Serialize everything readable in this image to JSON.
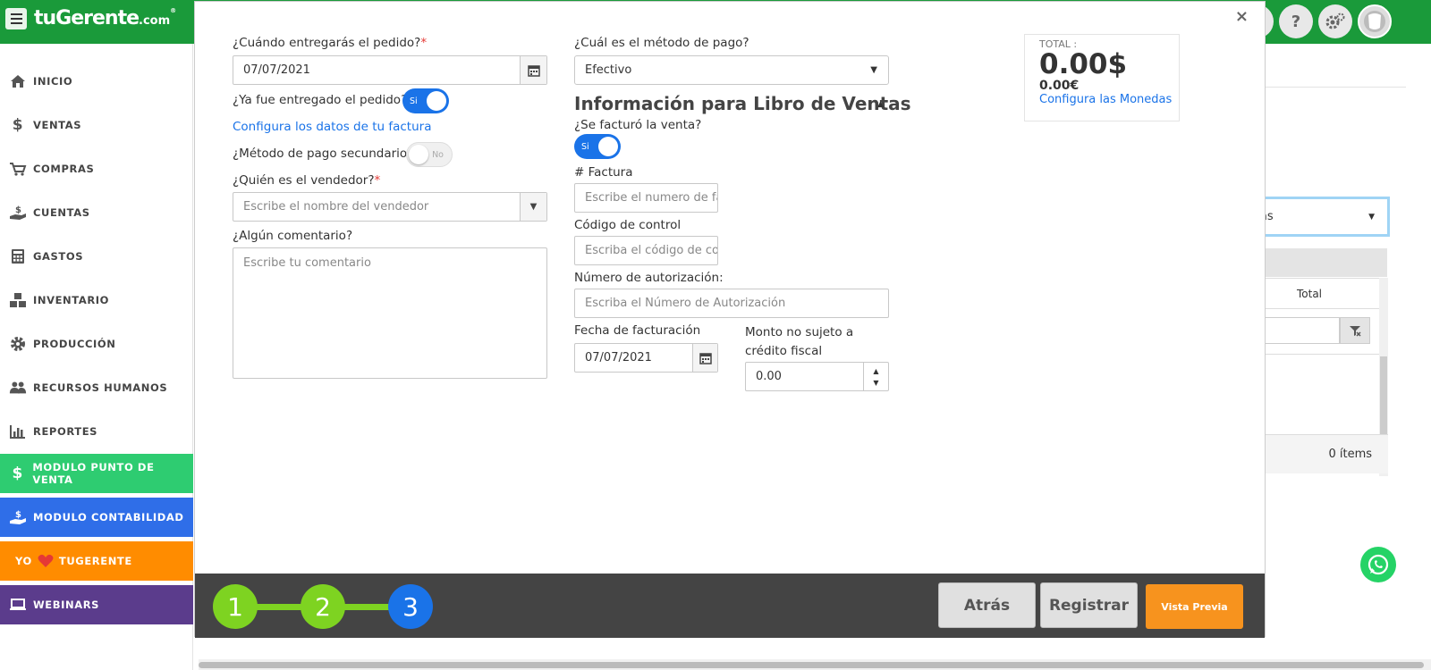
{
  "app": {
    "logo_main": "tuGerente",
    "logo_suffix": ".com",
    "logo_tm": "®"
  },
  "colors": {
    "topbar": "#1a9a3a",
    "accent_blue": "#1a73e8",
    "step_green": "#7ed321",
    "footer": "#444444",
    "orange": "#f7931e",
    "purple": "#5b3c8c",
    "pos_green": "#2ecc71",
    "contab_blue": "#2f6ee8"
  },
  "sidebar": {
    "items": [
      {
        "label": "INICIO",
        "icon": "home-icon"
      },
      {
        "label": "VENTAS",
        "icon": "dollar-icon"
      },
      {
        "label": "COMPRAS",
        "icon": "cart-icon"
      },
      {
        "label": "CUENTAS",
        "icon": "hand-money-icon"
      },
      {
        "label": "GASTOS",
        "icon": "calculator-icon"
      },
      {
        "label": "INVENTARIO",
        "icon": "boxes-icon"
      },
      {
        "label": "PRODUCCIÓN",
        "icon": "gear-icon"
      },
      {
        "label": "RECURSOS HUMANOS",
        "icon": "people-icon"
      },
      {
        "label": "REPORTES",
        "icon": "bar-chart-icon"
      },
      {
        "label": "MODULO PUNTO DE VENTA",
        "icon": "dollar-icon"
      },
      {
        "label": "MODULO CONTABILIDAD",
        "icon": "hand-money-icon"
      },
      {
        "label": "YO",
        "label2": "TUGERENTE",
        "icon": "heart-icon"
      },
      {
        "label": "WEBINARS",
        "icon": "laptop-icon"
      }
    ]
  },
  "background": {
    "columns_dropdown": "mnas",
    "total_header": "Total",
    "items_count": "0 ítems"
  },
  "modal": {
    "close": "×",
    "delivery_date": {
      "label": "¿Cuándo entregarás el pedido?",
      "required": "*",
      "value": "07/07/2021"
    },
    "delivered": {
      "label": "¿Ya fue entregado el pedido?",
      "toggle": "Si"
    },
    "invoice_config_link": "Configura los datos de tu factura",
    "secondary_payment": {
      "label": "¿Método de pago secundario?",
      "toggle": "No"
    },
    "seller": {
      "label": "¿Quién es el vendedor?",
      "required": "*",
      "placeholder": "Escribe el nombre del vendedor"
    },
    "comment": {
      "label": "¿Algún comentario?",
      "placeholder": "Escribe tu comentario"
    },
    "payment_method": {
      "label": "¿Cuál es el método de pago?",
      "value": "Efectivo"
    },
    "sales_book": {
      "title": "Información para Libro de Ventas",
      "invoiced": {
        "label": "¿Se facturó la venta?",
        "toggle": "Si"
      },
      "invoice_number": {
        "label": "# Factura",
        "placeholder": "Escribe el numero de factura"
      },
      "control_code": {
        "label": "Código de control",
        "placeholder": "Escriba el código de control"
      },
      "auth_number": {
        "label": "Número de autorización:",
        "placeholder": "Escriba el Número de Autorización"
      },
      "invoice_date": {
        "label": "Fecha de facturación",
        "value": "07/07/2021"
      },
      "non_credit_amount": {
        "label_line1": "Monto no sujeto a",
        "label_line2": "crédito fiscal",
        "value": "0.00"
      }
    },
    "totals": {
      "label": "TOTAL :",
      "main": "0.00$",
      "secondary": "0.00€",
      "link": "Configura las Monedas"
    },
    "footer": {
      "steps": [
        "1",
        "2",
        "3"
      ],
      "back": "Atrás",
      "register": "Registrar",
      "preview": "Vista Previa"
    }
  }
}
